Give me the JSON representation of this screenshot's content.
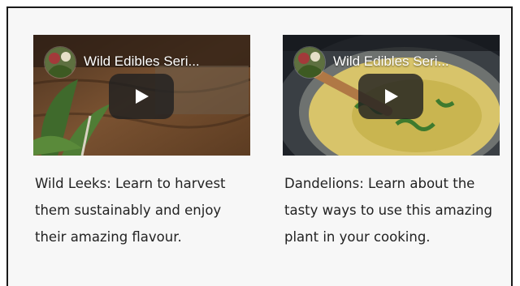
{
  "cards": [
    {
      "video_title": "Wild Edibles Seri...",
      "description": "Wild Leeks: Learn to harvest them sustainably and enjoy their amazing flavour."
    },
    {
      "video_title": "Wild Edibles Seri...",
      "description": "Dandelions: Learn about the tasty ways to use this amazing plant in your cooking."
    }
  ],
  "colors": {
    "frame_border": "#1a1a1a",
    "panel_bg": "#f7f7f7",
    "text": "#222222",
    "play_button": "#212121"
  }
}
